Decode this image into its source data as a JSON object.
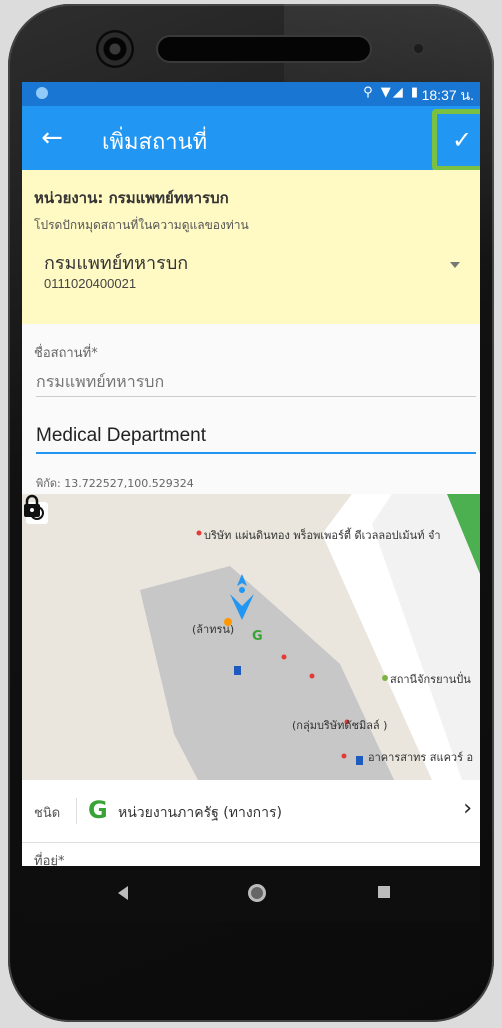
{
  "status_bar": {
    "icons": "⚲ ▼◢ ▮",
    "time": "18:37 น."
  },
  "app_bar": {
    "back_icon": "arrow-left",
    "title": "เพิ่มสถานที่",
    "confirm_icon": "checkmark"
  },
  "agency": {
    "title": "หน่วยงาน: กรมแพทย์ทหารบก",
    "hint": "โปรดปักหมุดสถานที่ในความดูแลของท่าน",
    "selected_name": "กรมแพทย์ทหารบก",
    "selected_code": "0111020400021"
  },
  "form": {
    "name_label": "ชื่อสถานที่*",
    "name_placeholder": "กรมแพทย์ทหารบก",
    "name_en_value": "Medical Department",
    "coordinates": "พิกัด: 13.722527,100.529324"
  },
  "map": {
    "labels": [
      "บริษัท แผ่นดินทอง พร็อพเพอร์ตี้ ดีเวลลอปเม้นท์ จำ",
      "(ล้าทรน)",
      "สถานีจักรยานปั่น",
      "(กลุ่มบริษัทดัชมิลล์ )",
      "อาคารสาทร สแควร์ อ"
    ],
    "colors": {
      "background": "#eae6de",
      "building": "#c7c7c7",
      "road": "#ffffff",
      "park": "#4caf50",
      "poi": "#e53935"
    }
  },
  "type_row": {
    "label": "ชนิด",
    "value": "หน่วยงานภาครัฐ (ทางการ)",
    "g_icon": "G",
    "chevron": "›"
  },
  "address": {
    "label": "ที่อยู่*"
  },
  "nav": {
    "back_icon": "triangle-back",
    "home_icon": "circle-home",
    "recent_icon": "square-recent"
  },
  "theme": {
    "primary": "#2196f3",
    "primary_dark": "#1976d2",
    "highlight": "#7ac143",
    "agency_bg": "#fff9c4"
  }
}
